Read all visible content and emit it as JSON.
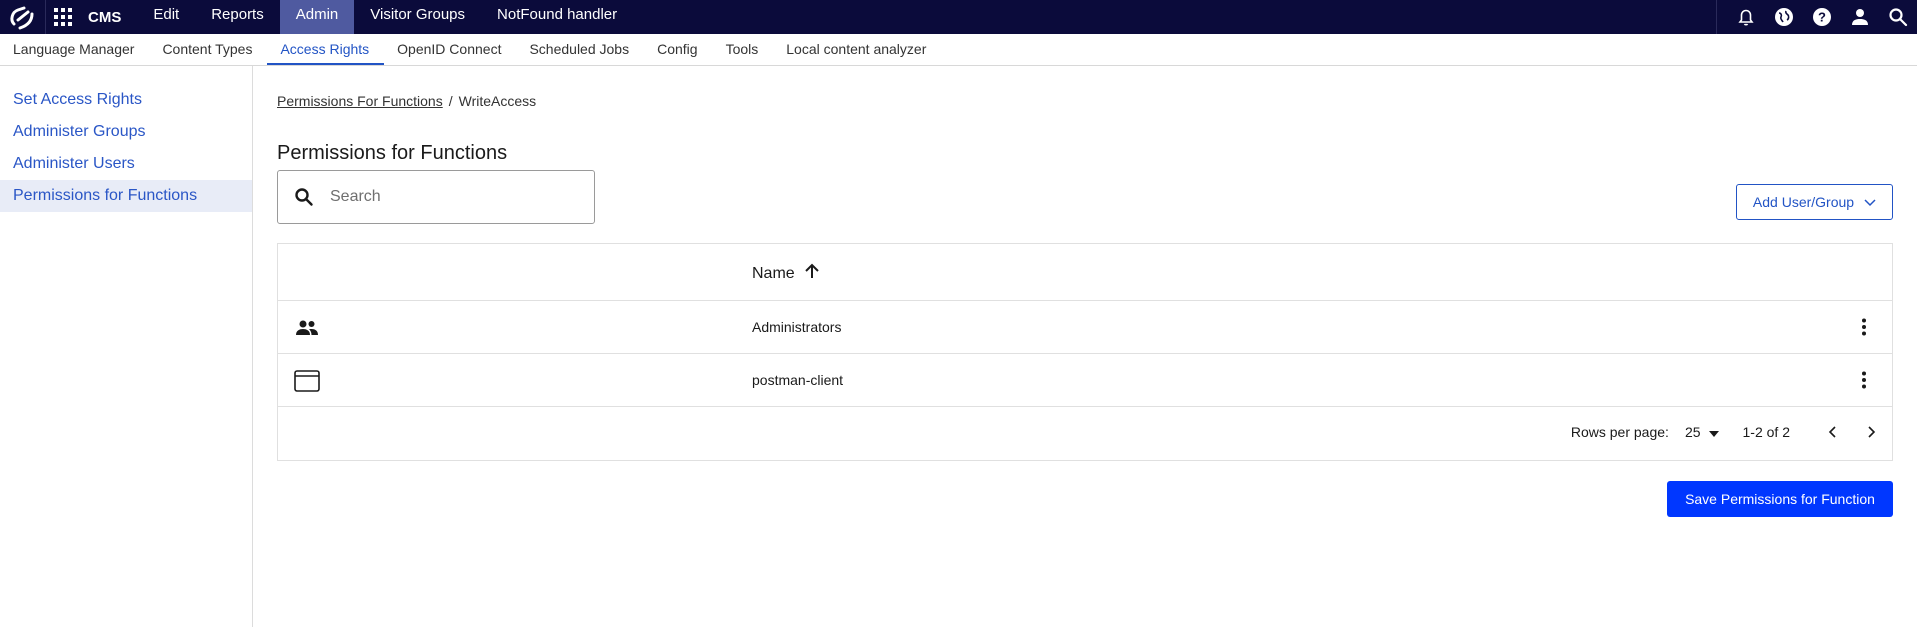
{
  "topbar": {
    "brand": "CMS",
    "nav": [
      {
        "label": "Edit",
        "active": false
      },
      {
        "label": "Reports",
        "active": false
      },
      {
        "label": "Admin",
        "active": true
      },
      {
        "label": "Visitor Groups",
        "active": false
      },
      {
        "label": "NotFound handler",
        "active": false
      }
    ],
    "icons": [
      "bell-icon",
      "globe-icon",
      "help-icon",
      "user-icon",
      "search-icon"
    ]
  },
  "subnav": {
    "items": [
      {
        "label": "Language Manager",
        "active": false
      },
      {
        "label": "Content Types",
        "active": false
      },
      {
        "label": "Access Rights",
        "active": true
      },
      {
        "label": "OpenID Connect",
        "active": false
      },
      {
        "label": "Scheduled Jobs",
        "active": false
      },
      {
        "label": "Config",
        "active": false
      },
      {
        "label": "Tools",
        "active": false
      },
      {
        "label": "Local content analyzer",
        "active": false
      }
    ]
  },
  "sidebar": {
    "items": [
      {
        "label": "Set Access Rights",
        "active": false
      },
      {
        "label": "Administer Groups",
        "active": false
      },
      {
        "label": "Administer Users",
        "active": false
      },
      {
        "label": "Permissions for Functions",
        "active": true
      }
    ]
  },
  "breadcrumb": {
    "link": "Permissions For Functions",
    "separator": "/",
    "current": "WriteAccess"
  },
  "main": {
    "title": "Permissions for Functions",
    "search_placeholder": "Search",
    "add_button": "Add User/Group",
    "save_button": "Save Permissions for Function"
  },
  "table": {
    "column_name": "Name",
    "sort": "ascending",
    "rows": [
      {
        "name": "Administrators",
        "icon": "group-icon"
      },
      {
        "name": "postman-client",
        "icon": "application-icon"
      }
    ],
    "rows_per_page_label": "Rows per page:",
    "rows_per_page": "25",
    "range": "1-2 of 2"
  },
  "colors": {
    "topbar_bg": "#0b0b3b",
    "admin_active": "#4f5aa0",
    "accent": "#2254c5",
    "primary_button": "#0037ff"
  }
}
